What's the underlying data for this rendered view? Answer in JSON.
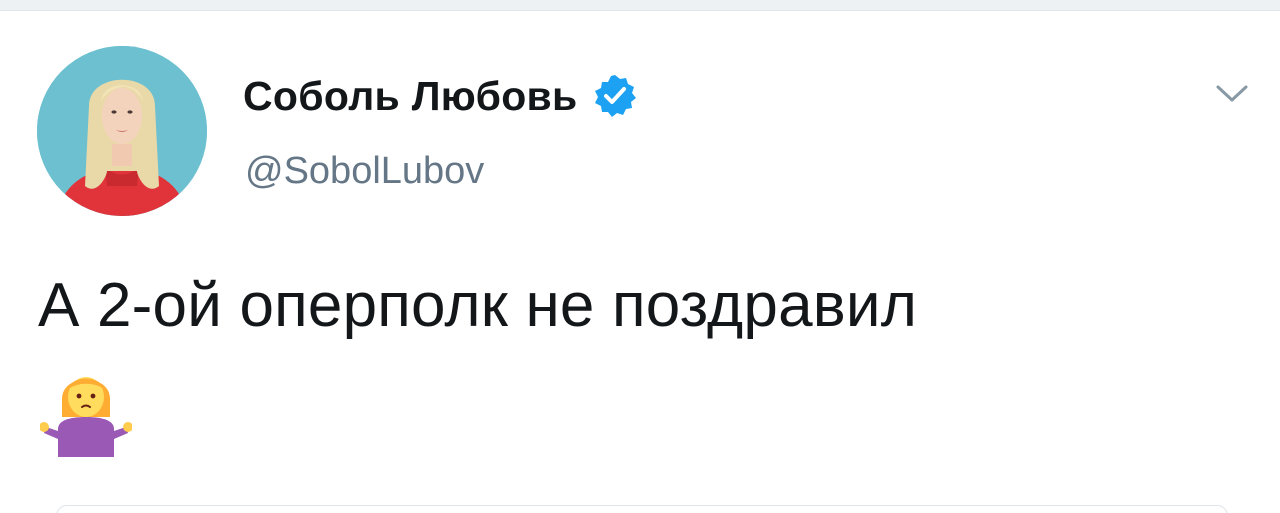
{
  "tweet": {
    "author": {
      "display_name": "Соболь Любовь",
      "username": "@SobolLubov",
      "verified": true,
      "avatar_icon": "profile-photo"
    },
    "text": "А 2-ой оперполк не поздравил",
    "emoji_icon": "person-shrugging-emoji",
    "menu_icon": "chevron-down-icon"
  },
  "colors": {
    "verified_blue": "#1da1f2",
    "text_primary": "#14171a",
    "text_secondary": "#657786",
    "divider": "#e1e6ea"
  }
}
